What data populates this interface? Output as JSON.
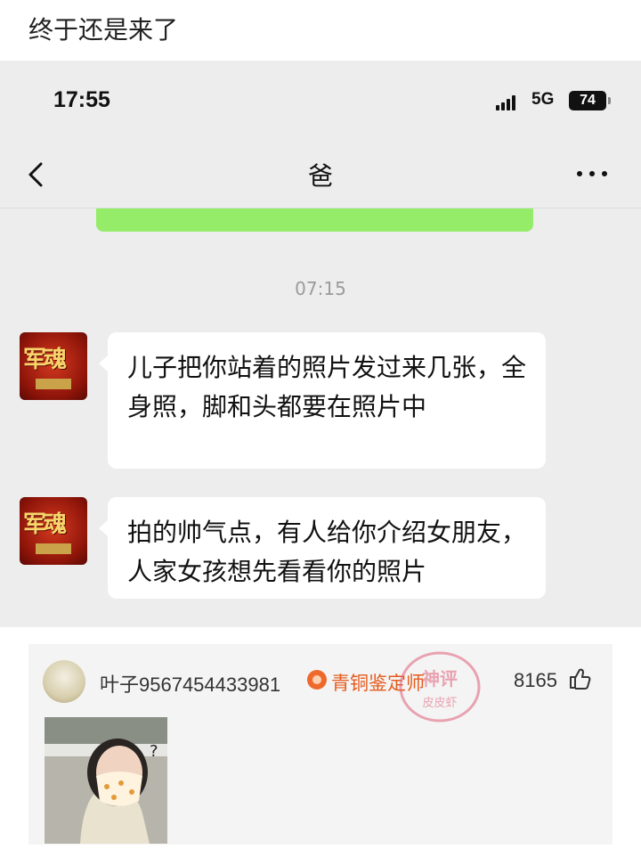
{
  "post": {
    "title": "终于还是来了"
  },
  "phone": {
    "time": "17:55",
    "network": "5G",
    "battery": "74"
  },
  "chat": {
    "contact_name": "爸",
    "timestamp": "07:15",
    "messages": [
      {
        "text": "儿子把你站着的照片发过来几张，全身照，脚和头都要在照片中"
      },
      {
        "text": "拍的帅气点，有人给你介绍女朋友，人家女孩想先看看你的照片"
      }
    ]
  },
  "comment": {
    "username": "叶子9567454433981",
    "badge": "青铜鉴定师",
    "likes": "8165",
    "stamp_text": "神评 皮皮虾"
  },
  "colors": {
    "chat_bg": "#ededed",
    "sent_bubble": "#95ec69",
    "received_bubble": "#ffffff",
    "badge": "#e55b1c",
    "stamp": "#e0607a"
  },
  "icons": [
    "back-chevron-icon",
    "more-dots-icon",
    "signal-icon",
    "battery-icon",
    "badge-icon",
    "thumbs-up-icon"
  ]
}
